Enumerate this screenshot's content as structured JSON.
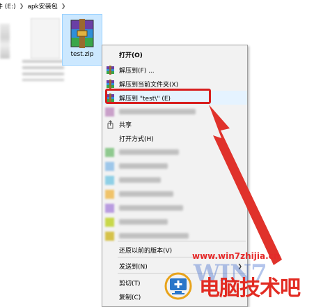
{
  "breadcrumb": {
    "drive": "文件 (E:)",
    "folder": "apk安装包"
  },
  "selected_file": {
    "name": "test.zip",
    "icon": "winrar-archive-icon"
  },
  "context_menu": {
    "open": "打开(O)",
    "extract_to": "解压到(F) ...",
    "extract_here": "解压到当前文件夹(X)",
    "extract_to_folder": "解压到 \"test\\\" (E)",
    "share": "共享",
    "open_with": "打开方式(H)",
    "restore_versions": "还原以前的版本(V)",
    "send_to": "发送到(N)",
    "cut": "剪切(T)",
    "copy": "复制(C)"
  },
  "colors": {
    "highlight_border": "#d81e1e",
    "arrow": "#e0322b",
    "menu_bg": "#f2f2f2",
    "selection_bg": "#cce8ff"
  },
  "watermark": {
    "url": "www.win7zhijia.cn",
    "brand": "电脑技术吧",
    "logo_text": "WIN7"
  }
}
